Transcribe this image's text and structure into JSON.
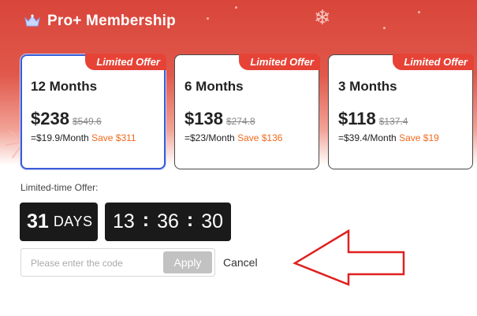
{
  "header": {
    "title": "Pro+ Membership",
    "icon": "crown-icon"
  },
  "plans": [
    {
      "badge": "Limited Offer",
      "duration": "12 Months",
      "price": "$238",
      "original_price": "$549.6",
      "monthly": "=$19.9/Month",
      "save": "Save $311",
      "selected": true
    },
    {
      "badge": "Limited Offer",
      "duration": "6 Months",
      "price": "$138",
      "original_price": "$274.8",
      "monthly": "=$23/Month",
      "save": "Save $136",
      "selected": false
    },
    {
      "badge": "Limited Offer",
      "duration": "3 Months",
      "price": "$118",
      "original_price": "$137.4",
      "monthly": "=$39.4/Month",
      "save": "Save $19",
      "selected": false
    }
  ],
  "offer": {
    "label": "Limited-time Offer:",
    "days": "31",
    "days_unit": "DAYS",
    "hours": "13",
    "minutes": "36",
    "seconds": "30"
  },
  "promo": {
    "placeholder": "Please enter the code",
    "value": "",
    "apply_label": "Apply",
    "cancel_label": "Cancel"
  },
  "colors": {
    "brand_red": "#e64336",
    "save_orange": "#f06a1d",
    "selected_border": "#3b5bd6",
    "timer_bg": "#1a1a1a",
    "arrow_red": "#e02020"
  }
}
